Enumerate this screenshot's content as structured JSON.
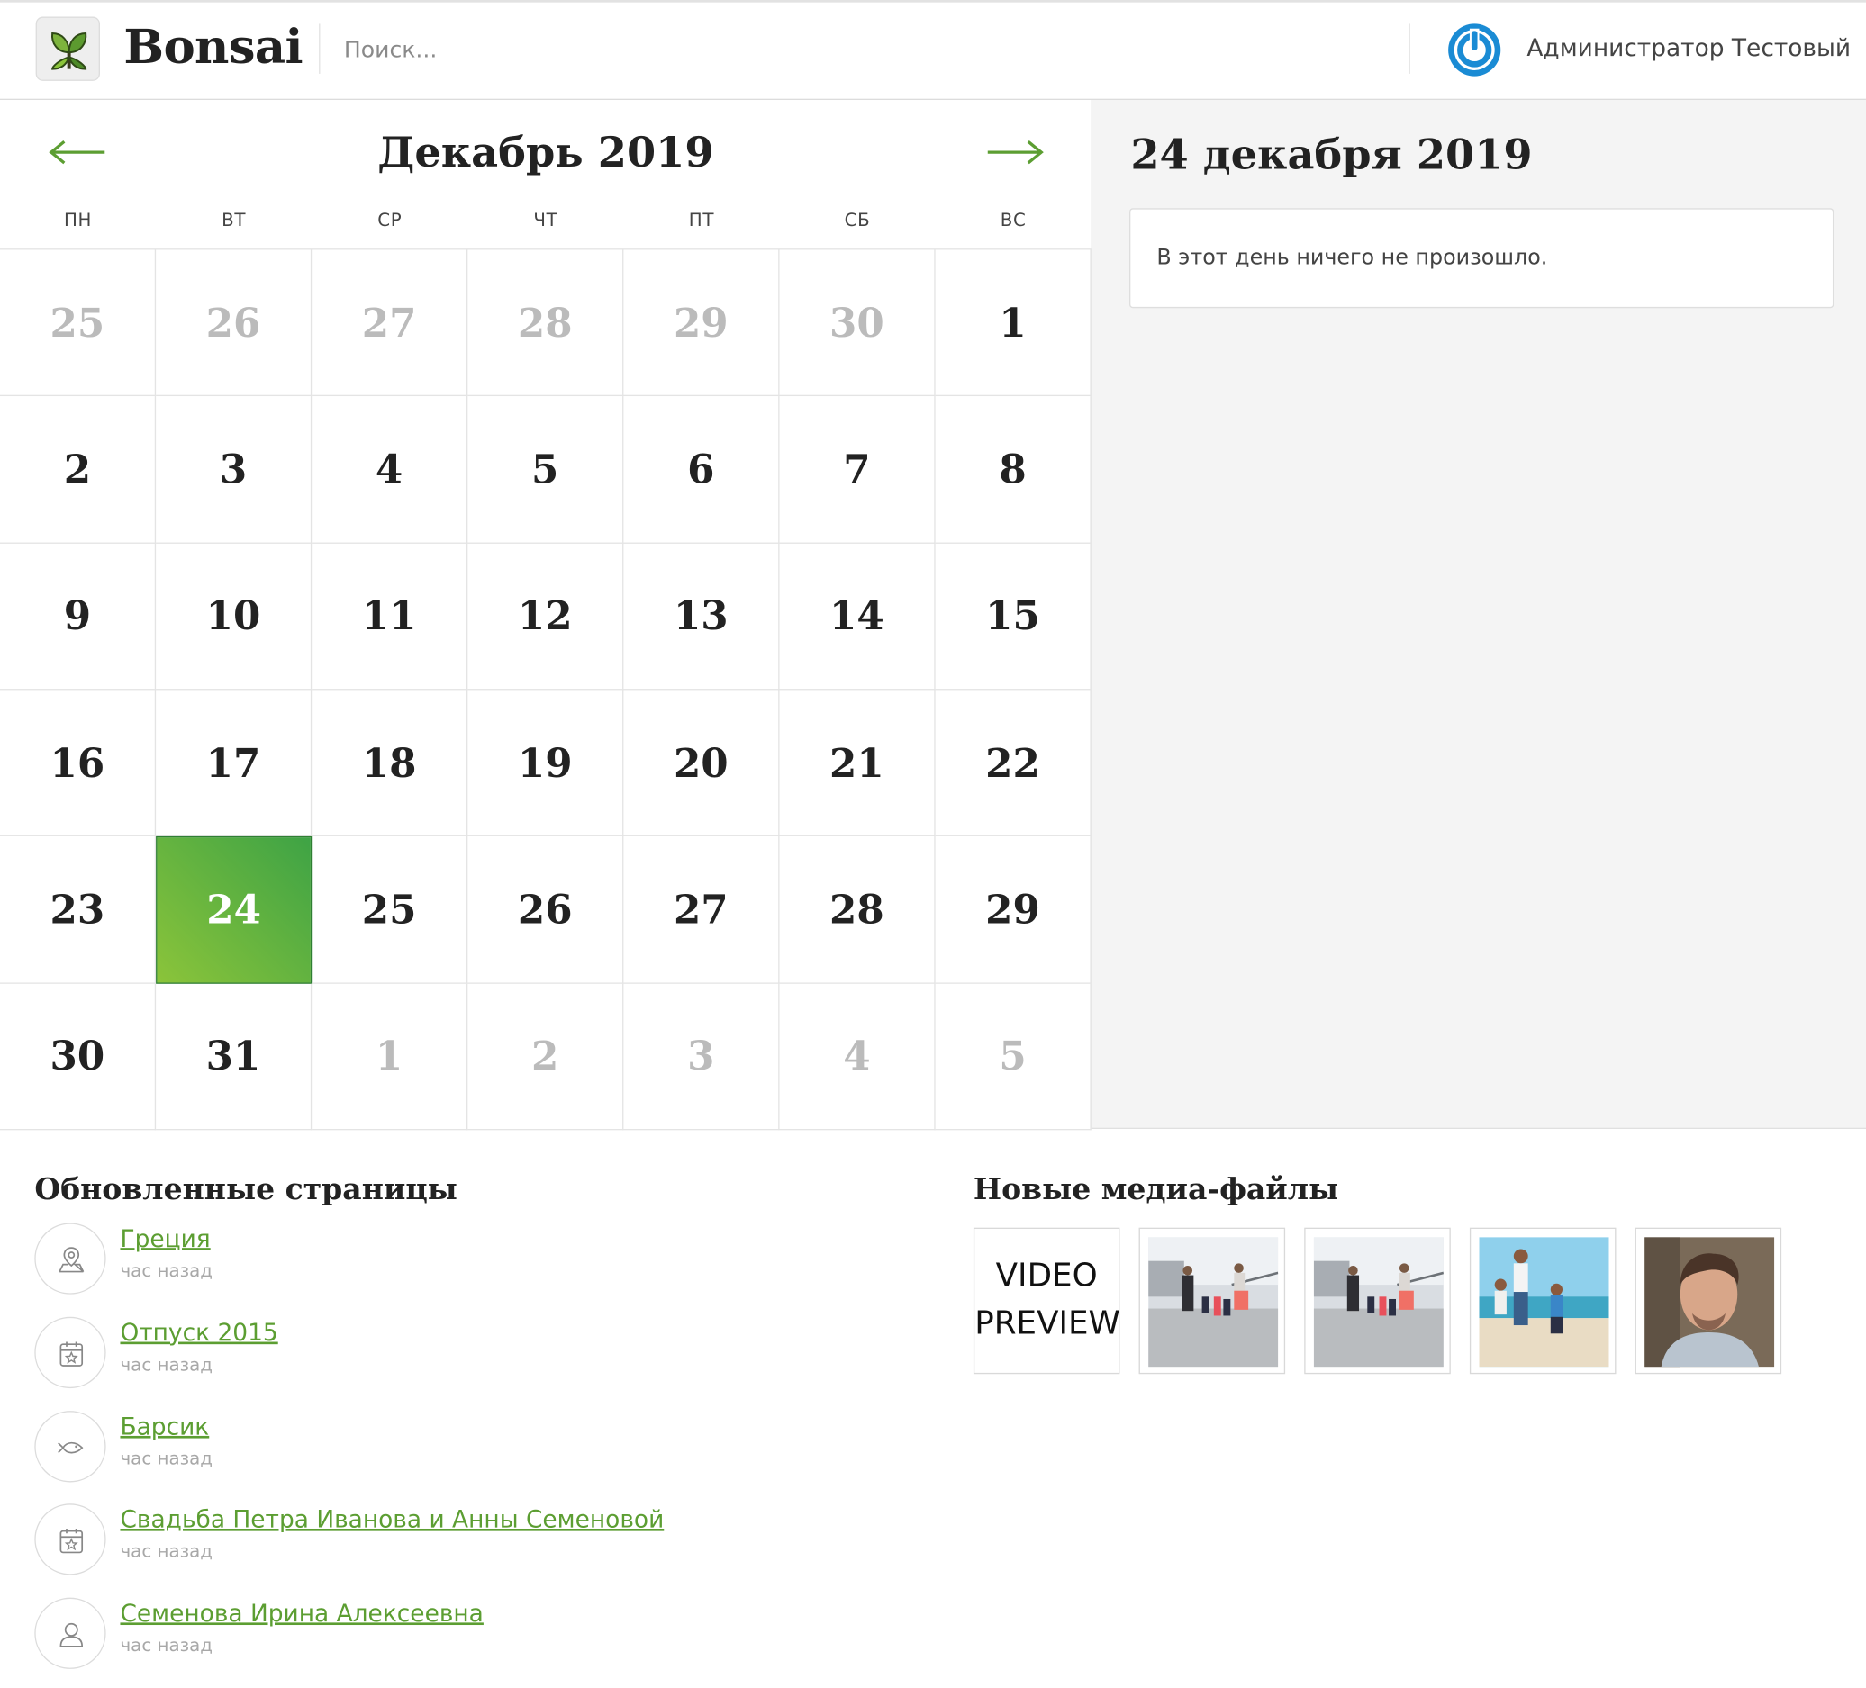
{
  "header": {
    "brand": "Bonsai",
    "search_placeholder": "Поиск...",
    "user_name": "Администратор Тестовый"
  },
  "calendar": {
    "month_title": "Декабрь 2019",
    "weekdays": [
      "ПН",
      "ВТ",
      "СР",
      "ЧТ",
      "ПТ",
      "СБ",
      "ВС"
    ],
    "days": [
      {
        "label": "25",
        "muted": true
      },
      {
        "label": "26",
        "muted": true
      },
      {
        "label": "27",
        "muted": true
      },
      {
        "label": "28",
        "muted": true
      },
      {
        "label": "29",
        "muted": true
      },
      {
        "label": "30",
        "muted": true
      },
      {
        "label": "1",
        "muted": false
      },
      {
        "label": "2",
        "muted": false
      },
      {
        "label": "3",
        "muted": false
      },
      {
        "label": "4",
        "muted": false
      },
      {
        "label": "5",
        "muted": false
      },
      {
        "label": "6",
        "muted": false
      },
      {
        "label": "7",
        "muted": false
      },
      {
        "label": "8",
        "muted": false
      },
      {
        "label": "9",
        "muted": false
      },
      {
        "label": "10",
        "muted": false
      },
      {
        "label": "11",
        "muted": false
      },
      {
        "label": "12",
        "muted": false
      },
      {
        "label": "13",
        "muted": false
      },
      {
        "label": "14",
        "muted": false
      },
      {
        "label": "15",
        "muted": false
      },
      {
        "label": "16",
        "muted": false
      },
      {
        "label": "17",
        "muted": false
      },
      {
        "label": "18",
        "muted": false
      },
      {
        "label": "19",
        "muted": false
      },
      {
        "label": "20",
        "muted": false
      },
      {
        "label": "21",
        "muted": false
      },
      {
        "label": "22",
        "muted": false
      },
      {
        "label": "23",
        "muted": false
      },
      {
        "label": "24",
        "muted": false,
        "selected": true
      },
      {
        "label": "25",
        "muted": false
      },
      {
        "label": "26",
        "muted": false
      },
      {
        "label": "27",
        "muted": false
      },
      {
        "label": "28",
        "muted": false
      },
      {
        "label": "29",
        "muted": false
      },
      {
        "label": "30",
        "muted": false
      },
      {
        "label": "31",
        "muted": false
      },
      {
        "label": "1",
        "muted": true
      },
      {
        "label": "2",
        "muted": true
      },
      {
        "label": "3",
        "muted": true
      },
      {
        "label": "4",
        "muted": true
      },
      {
        "label": "5",
        "muted": true
      }
    ]
  },
  "day_panel": {
    "title": "24 декабря 2019",
    "empty_text": "В этот день ничего не произошло."
  },
  "updated_pages": {
    "heading": "Обновленные страницы",
    "items": [
      {
        "title": "Греция",
        "time": "час назад",
        "icon": "map-pin-icon"
      },
      {
        "title": "Отпуск 2015",
        "time": "час назад",
        "icon": "calendar-star-icon"
      },
      {
        "title": "Барсик",
        "time": "час назад",
        "icon": "fish-icon"
      },
      {
        "title": "Свадьба Петра Иванова и Анны Семеновой",
        "time": "час назад",
        "icon": "calendar-star-icon"
      },
      {
        "title": "Семенова Ирина Алексеевна",
        "time": "час назад",
        "icon": "person-icon"
      }
    ]
  },
  "new_media": {
    "heading": "Новые медиа-файлы",
    "video_label_line1": "VIDEO",
    "video_label_line2": "PREVIEW",
    "items": [
      "video-preview",
      "family-photo",
      "family-photo",
      "beach-photo",
      "portrait-photo"
    ]
  },
  "colors": {
    "accent_green": "#5c9e32",
    "selected_gradient_start": "#8bc43a",
    "selected_gradient_end": "#3ea345",
    "user_icon_blue": "#1a8bd4"
  }
}
